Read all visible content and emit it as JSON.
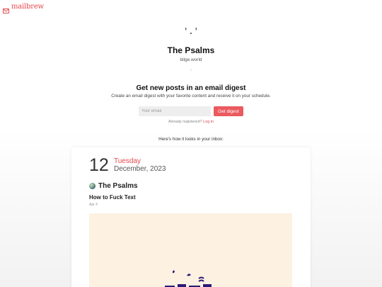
{
  "brand": {
    "name": "mailbrew",
    "color": "#e5484d"
  },
  "profile": {
    "avatar_text": "'.'",
    "title": "The Psalms",
    "domain": "bilge.world"
  },
  "signup": {
    "heading": "Get new posts in an email digest",
    "description": "Create an email digest with your favorite content and receive it on your schedule.",
    "email_placeholder": "Your email",
    "button_label": "Get digest",
    "already_registered": "Already registered?",
    "login_label": "Log in",
    "accent": "#ea5a5f"
  },
  "preview": {
    "label": "Here's how it looks in your inbox:",
    "date_day": "12",
    "date_weekday": "Tuesday",
    "date_month": "December, 2023",
    "source_icon": "globe-icon",
    "source_name": "The Psalms",
    "post_title": "How to Fuck Text",
    "post_meta": "Apr 4",
    "image_bg": "#fdf1e1"
  }
}
